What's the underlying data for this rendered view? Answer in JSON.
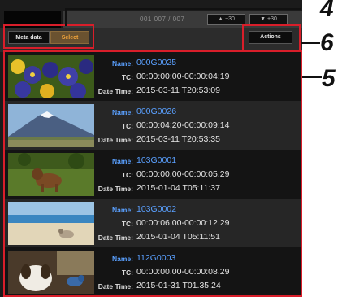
{
  "status_bar": {
    "counter": "001 007 / 007",
    "skip_back": "▲ −30",
    "skip_forward": "▼ +30"
  },
  "toolbar": {
    "meta_data_label": "Meta data",
    "select_label": "Select",
    "actions_label": "Actions"
  },
  "labels": {
    "name": "Name:",
    "tc": "TC:",
    "date_time": "Date Time:"
  },
  "clips": [
    {
      "name": "000G0025",
      "tc": "00:00:00:00-00:00:04:19",
      "date_time": "2015-03-11 T20:53:09"
    },
    {
      "name": "000G0026",
      "tc": "00:00:04:20-00:00:09:14",
      "date_time": "2015-03-11 T20:53:35"
    },
    {
      "name": "103G0001",
      "tc": "00:00:00.00-00:00:05.29",
      "date_time": "2015-01-04 T05:11:37"
    },
    {
      "name": "103G0002",
      "tc": "00:00:06.00-00:00:12.29",
      "date_time": "2015-01-04 T05:11:51"
    },
    {
      "name": "112G0003",
      "tc": "00:00:00.00-00:00:08.29",
      "date_time": "2015-01-31 T01.35.24"
    }
  ],
  "callouts": {
    "c4": "4",
    "c6": "6",
    "c5": "5"
  },
  "colors": {
    "highlight": "#d91e2a",
    "clip_name": "#5aa0ff",
    "select_accent": "#f0a33a"
  }
}
